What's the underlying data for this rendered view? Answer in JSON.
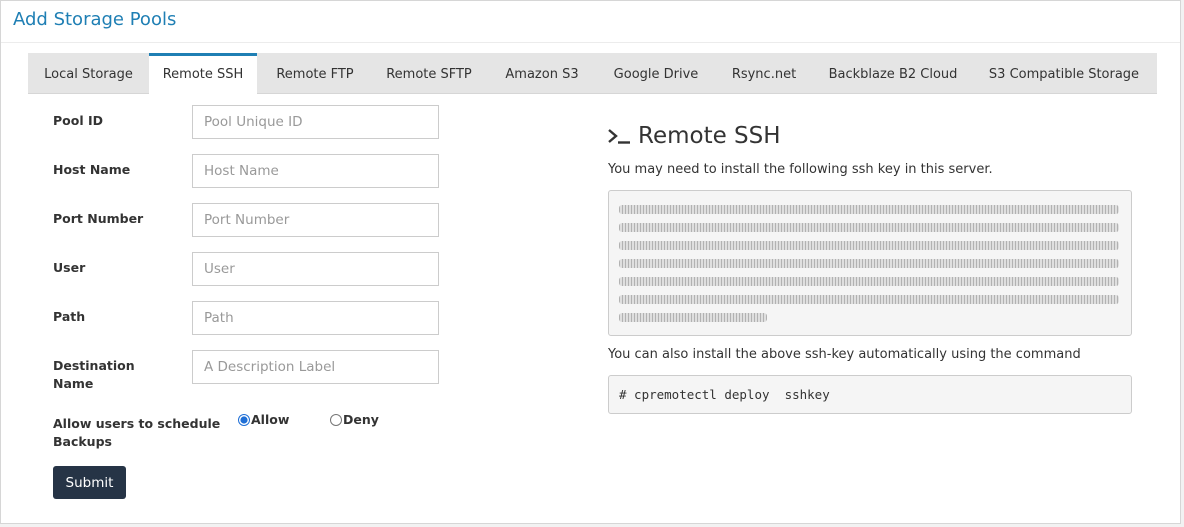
{
  "page": {
    "title": "Add Storage Pools"
  },
  "tabs": [
    {
      "label": "Local Storage",
      "active": false
    },
    {
      "label": "Remote SSH",
      "active": true
    },
    {
      "label": "Remote FTP",
      "active": false
    },
    {
      "label": "Remote SFTP",
      "active": false
    },
    {
      "label": "Amazon S3",
      "active": false
    },
    {
      "label": "Google Drive",
      "active": false
    },
    {
      "label": "Rsync.net",
      "active": false
    },
    {
      "label": "Backblaze B2 Cloud",
      "active": false
    },
    {
      "label": "S3 Compatible Storage",
      "active": false
    }
  ],
  "form": {
    "fields": [
      {
        "label": "Pool ID",
        "placeholder": "Pool Unique ID",
        "value": ""
      },
      {
        "label": "Host Name",
        "placeholder": "Host Name",
        "value": ""
      },
      {
        "label": "Port Number",
        "placeholder": "Port Number",
        "value": ""
      },
      {
        "label": "User",
        "placeholder": "User",
        "value": ""
      },
      {
        "label": "Path",
        "placeholder": "Path",
        "value": ""
      },
      {
        "label": "Destination\nName",
        "placeholder": "A Description Label",
        "value": ""
      }
    ],
    "schedule": {
      "label": "Allow users to schedule\nBackups",
      "options": [
        {
          "label": "Allow",
          "checked": true
        },
        {
          "label": "Deny",
          "checked": false
        }
      ]
    },
    "submit_label": "Submit"
  },
  "ssh_panel": {
    "title": "Remote SSH",
    "note": "You may need to install the following ssh key in this server.",
    "key_redacted": true,
    "auto_note": "You can also install the above ssh-key automatically using the command",
    "command": "# cpremotectl deploy  sshkey"
  },
  "colors": {
    "accent": "#1f7fb4",
    "button": "#263446"
  }
}
